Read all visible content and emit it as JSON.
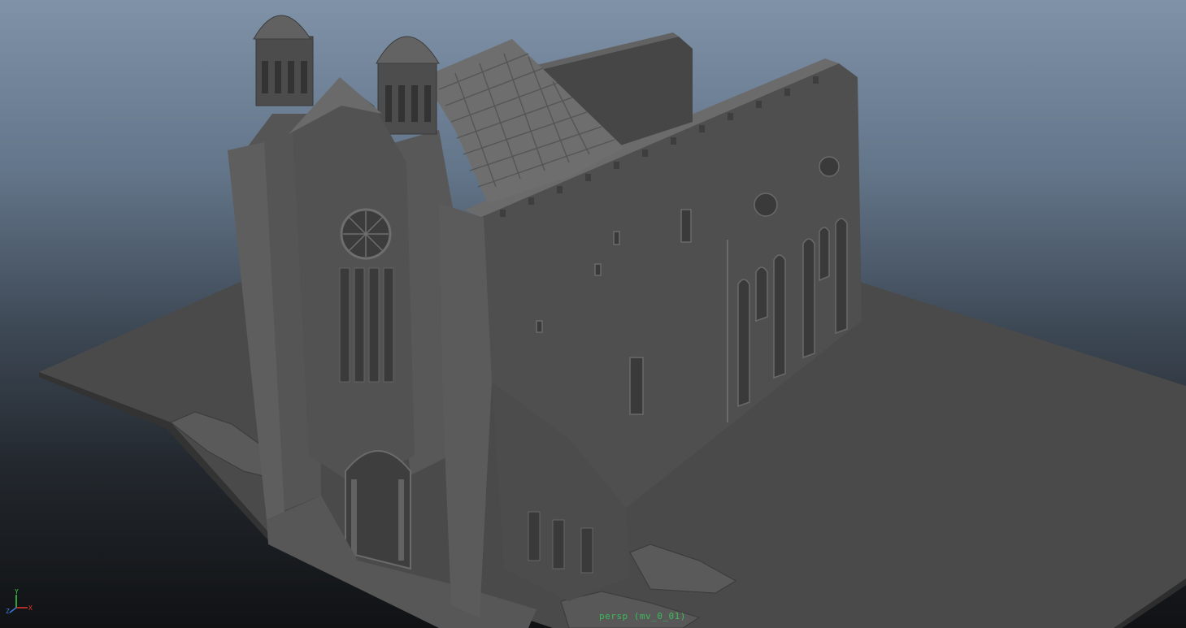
{
  "viewport": {
    "camera_label": "persp (mv_0_01)",
    "background_top": "#7f92a8",
    "background_bottom": "#101214",
    "ground_color": "#4b4b4b",
    "model_color": "#555555"
  },
  "axis_gizmo": {
    "x_color": "#e03a2c",
    "y_color": "#3ad24a",
    "z_color": "#3a7ae0"
  }
}
